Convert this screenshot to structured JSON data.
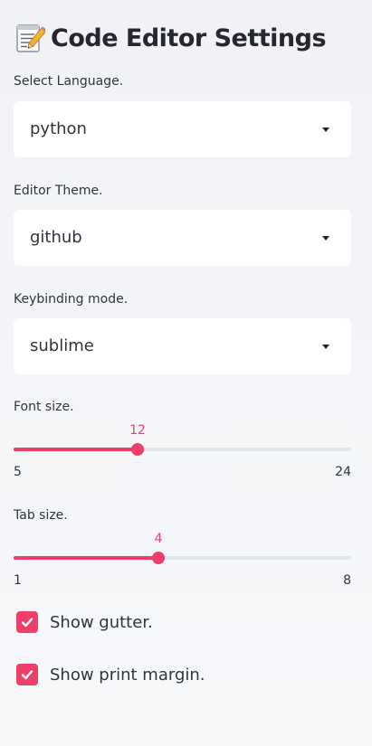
{
  "sidebar": {
    "title": "Code Editor Settings",
    "title_icon": "memo-icon",
    "accent_color": "#ee3f6a",
    "language": {
      "label": "Select Language.",
      "value": "python"
    },
    "theme": {
      "label": "Editor Theme.",
      "value": "github"
    },
    "keybinding": {
      "label": "Keybinding mode.",
      "value": "sublime"
    },
    "font_size": {
      "label": "Font size.",
      "value": 12,
      "min": 5,
      "max": 24
    },
    "tab_size": {
      "label": "Tab size.",
      "value": 4,
      "min": 1,
      "max": 8
    },
    "show_gutter": {
      "label": "Show gutter.",
      "checked": true
    },
    "show_print_margin": {
      "label": "Show print margin.",
      "checked": true
    }
  }
}
